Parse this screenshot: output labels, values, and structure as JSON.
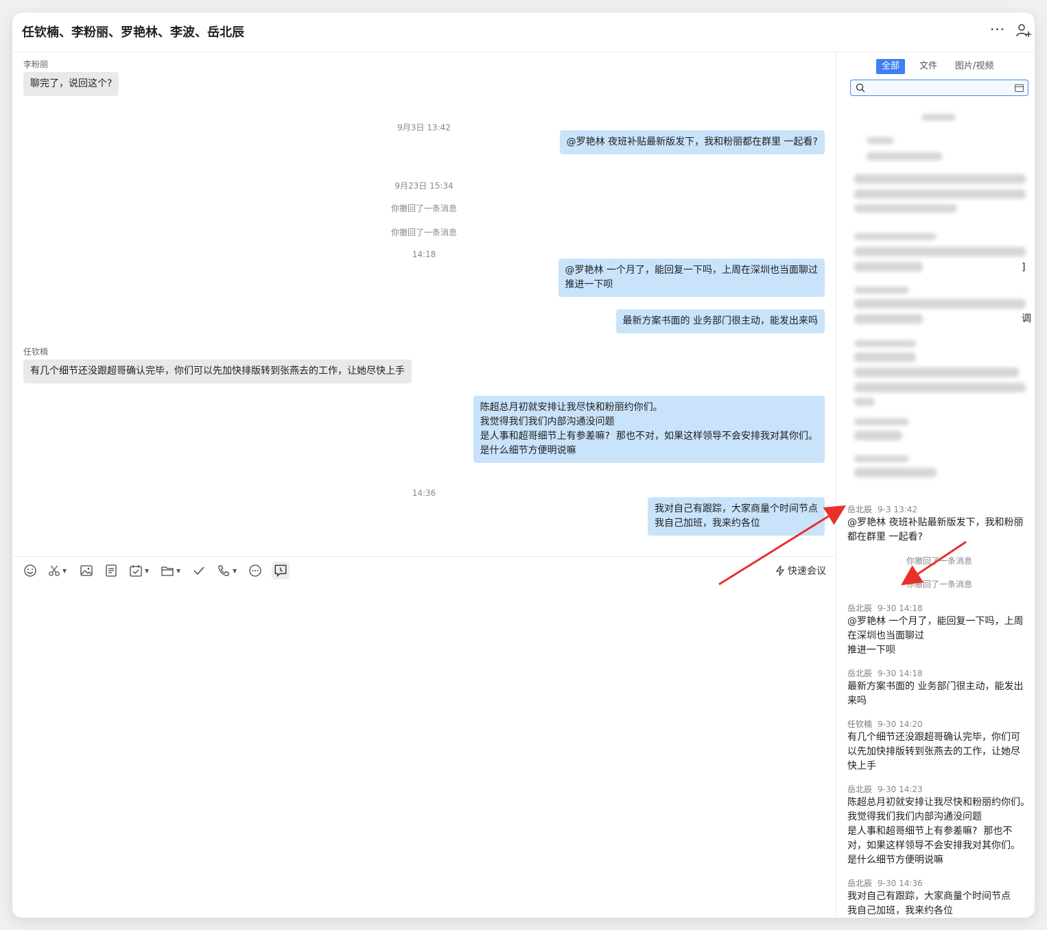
{
  "window": {
    "title": "任钦楠、李粉丽、罗艳林、李波、岳北辰"
  },
  "header": {
    "more_label": "···",
    "add_user_icon": "add-user-icon"
  },
  "chat": {
    "sender_li": "李粉丽",
    "msg_li": "聊完了，说回这个?",
    "time_1": "9月3日 13:42",
    "msg_out_1": "@罗艳林 夜班补贴最新版发下，我和粉丽都在群里 一起看?",
    "time_2": "9月23日 15:34",
    "recall_1": "你撤回了一条消息",
    "recall_2": "你撤回了一条消息",
    "time_3": "14:18",
    "msg_out_2": "@罗艳林 一个月了，能回复一下吗，上周在深圳也当面聊过\n推进一下呗",
    "msg_out_3": "最新方案书面的 业务部门很主动，能发出来吗",
    "sender_ren": "任钦楠",
    "msg_ren": "有几个细节还没跟超哥确认完毕，你们可以先加快排版转到张燕去的工作，让她尽快上手",
    "msg_out_4": "陈超总月初就安排让我尽快和粉丽约你们。\n我觉得我们我们内部沟通没问题\n是人事和超哥细节上有参差嘛?  那也不对，如果这样领导不会安排我对其你们。\n是什么细节方便明说嘛",
    "time_4": "14:36",
    "msg_out_5": "我对自己有跟踪，大家商量个时间节点\n我自己加班，我来约各位"
  },
  "toolbar": {
    "icons": [
      "emoji-icon",
      "scissors-icon",
      "image-icon",
      "document-icon",
      "calendar-check-icon",
      "folder-icon",
      "checkmark-icon",
      "phone-icon",
      "more-circle-icon",
      "history-icon"
    ],
    "quick_meeting": "快速会议"
  },
  "panel": {
    "tabs": [
      "全部",
      "文件",
      "图片/视频"
    ],
    "search_placeholder": "",
    "history": [
      {
        "name": "岳北辰",
        "time": "9-3 13:42",
        "text": "@罗艳林 夜班补贴最新版发下，我和粉丽\n都在群里 一起看?"
      },
      {
        "name": "岳北辰",
        "time": "9-30 14:18",
        "text": "@罗艳林 一个月了，能回复一下吗，上周\n在深圳也当面聊过\n推进一下呗"
      },
      {
        "name": "岳北辰",
        "time": "9-30 14:18",
        "text": "最新方案书面的 业务部门很主动，能发出\n来吗"
      },
      {
        "name": "任钦楠",
        "time": "9-30 14:20",
        "text": "有几个细节还没跟超哥确认完毕，你们可\n以先加快排版转到张燕去的工作，让她尽\n快上手"
      },
      {
        "name": "岳北辰",
        "time": "9-30 14:23",
        "text": "陈超总月初就安排让我尽快和粉丽约你们。\n我觉得我们我们内部沟通没问题\n是人事和超哥细节上有参差嘛?  那也不\n对，如果这样领导不会安排我对其你们。\n是什么细节方便明说嘛"
      },
      {
        "name": "岳北辰",
        "time": "9-30 14:36",
        "text": "我对自己有跟踪，大家商量个时间节点\n我自己加班，我来约各位"
      }
    ],
    "recall_1": "你撤回了一条消息",
    "recall_2": "你撤回了一条消息",
    "edge_char_1": "调",
    "edge_char_2": "]"
  },
  "colors": {
    "accent": "#3d7ff5",
    "outgoing_bubble": "#c9e3fb",
    "incoming_bubble": "#e9e9e9",
    "annotation_arrow": "#e8302a"
  }
}
